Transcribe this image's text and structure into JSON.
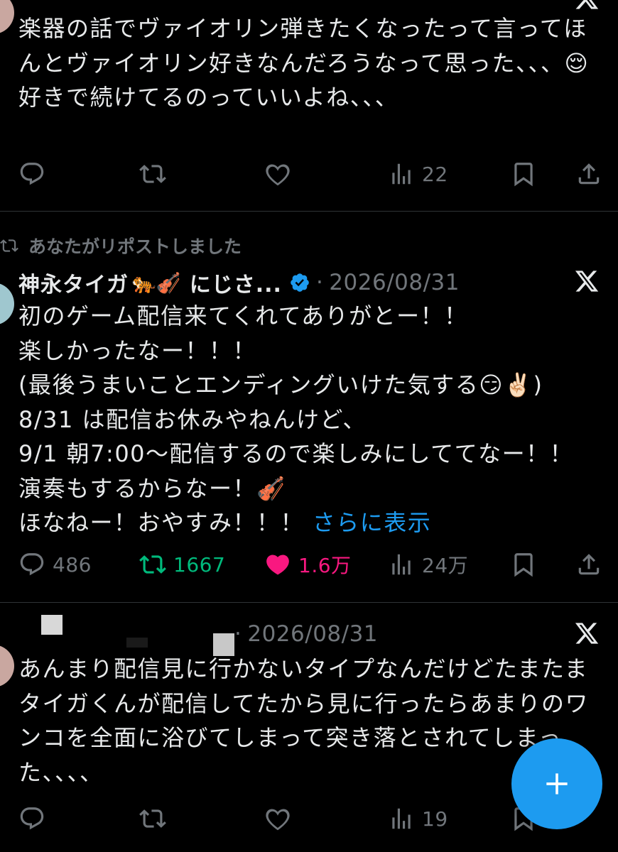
{
  "tweet1": {
    "text": "楽器の話でヴァイオリン弾きたくなったって言ってほんとヴァイオリン好きなんだろうなって思った、、、😌\n好きで続けてるのっていいよね、、、",
    "views": "22"
  },
  "tweet2": {
    "repost_label": "あなたがリポストしました",
    "display_name": "神永タイガ",
    "name_emoji": "🐅🎻",
    "name_suffix": "にじさ...",
    "separator": "·",
    "date": "2026/08/31",
    "text": "初のゲーム配信来てくれてありがとー！！\n楽しかったなー！！！\n(最後うまいことエンディングいけた気する😏✌🏻)\n8/31 は配信お休みやねんけど、\n9/1 朝7:00〜配信するので楽しみにしててなー！！\n演奏もするからなー！🎻\nほなねー！おやすみ！！！ ",
    "show_more": "さらに表示",
    "replies": "486",
    "reposts": "1667",
    "likes": "1.6万",
    "views": "24万",
    "colors": {
      "repost": "#00ba7c",
      "like": "#f91880"
    }
  },
  "tweet3": {
    "separator": "·",
    "date": "2026/08/31",
    "text": "あんまり配信見に行かないタイプなんだけどたまたまタイガくんが配信してたから見に行ったらあまりのワンコを全面に浴びてしまって突き落とされてしまった、、、、",
    "views": "19"
  },
  "fab": {
    "icon": "plus-icon"
  },
  "colors": {
    "accent": "#1d9bf0",
    "muted": "#71767b",
    "text": "#e7e9ea",
    "background": "#000000"
  }
}
